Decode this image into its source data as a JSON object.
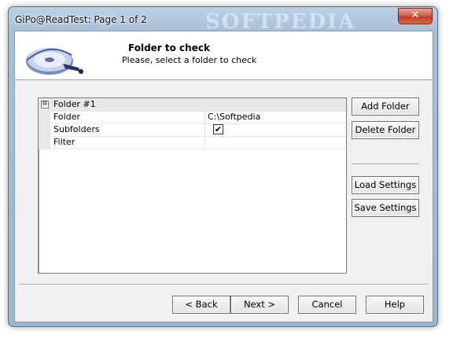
{
  "window": {
    "title": "GiPo@ReadTest: Page 1 of 2",
    "watermark": "SOFTPEDIA",
    "close_glyph": "✕"
  },
  "header": {
    "title": "Folder to check",
    "subtitle": "Please, select a folder to check"
  },
  "grid": {
    "group_label": "Folder #1",
    "group_expanded_glyph": "⊟",
    "rows": [
      {
        "name": "Folder",
        "value": "C:\\Softpedia"
      },
      {
        "name": "Subfolders",
        "value": "",
        "checked": true
      },
      {
        "name": "Filter",
        "value": ""
      }
    ]
  },
  "side_buttons": {
    "add": "Add Folder",
    "delete": "Delete Folder",
    "load": "Load Settings",
    "save": "Save Settings"
  },
  "footer_buttons": {
    "back": "< Back",
    "next": "Next >",
    "cancel": "Cancel",
    "help": "Help"
  },
  "colors": {
    "frame": "#a8c0d8",
    "client": "#f0f0f0",
    "close": "#c13d25"
  }
}
